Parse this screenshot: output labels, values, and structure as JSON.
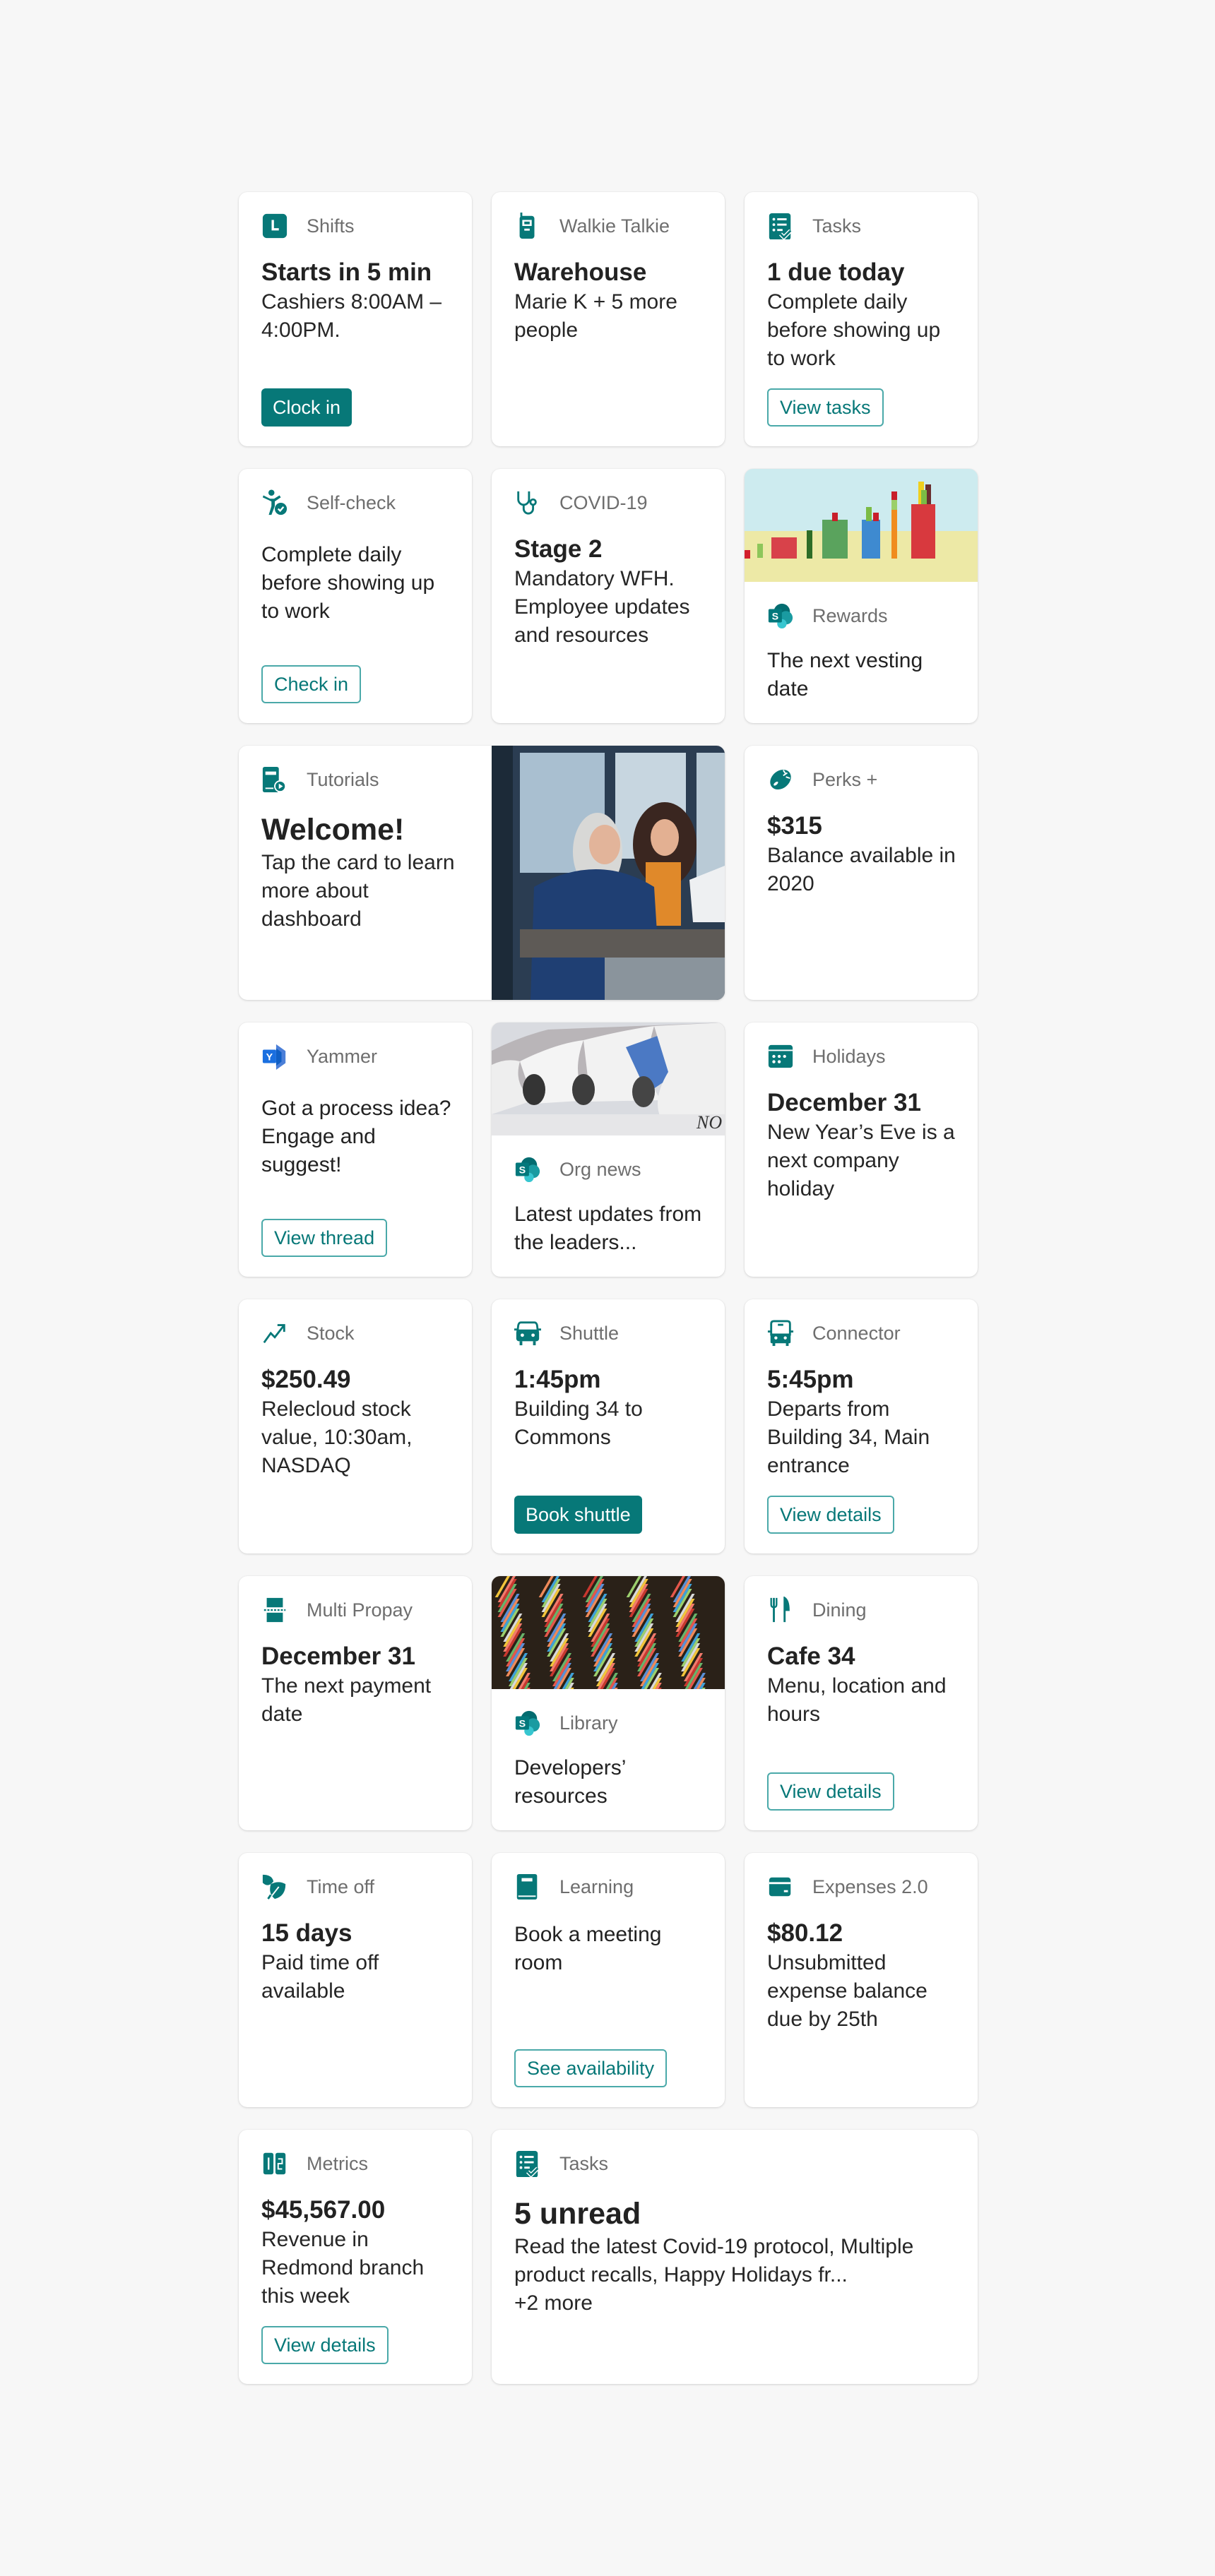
{
  "theme": {
    "accent": "#077878",
    "accent_border": "#4aa9a9",
    "page_bg": "#f7f7f7"
  },
  "cards": {
    "shifts": {
      "icon": "shifts-clock-icon",
      "label": "Shifts",
      "title": "Starts in 5 min",
      "body": "Cashiers 8:00AM – 4:00PM.",
      "button": "Clock in"
    },
    "walkie": {
      "icon": "walkie-talkie-icon",
      "label": "Walkie Talkie",
      "title": "Warehouse",
      "body": "Marie K + 5 more people"
    },
    "tasks1": {
      "icon": "tasks-checklist-icon",
      "label": "Tasks",
      "title": "1 due today",
      "body": "Complete daily before showing up to work",
      "button": "View tasks"
    },
    "selfcheck": {
      "icon": "self-check-person-icon",
      "label": "Self-check",
      "body": "Complete daily before showing up to work",
      "button": "Check in"
    },
    "covid": {
      "icon": "stethoscope-icon",
      "label": "COVID-19",
      "title": "Stage 2",
      "body": "Mandatory WFH. Employee updates and resources"
    },
    "rewards": {
      "icon": "sharepoint-icon",
      "label": "Rewards",
      "body": "The next vesting date",
      "image": "colorful-blocks-bar-photo"
    },
    "tutorials": {
      "icon": "tutorial-book-play-icon",
      "label": "Tutorials",
      "title": "Welcome!",
      "body": "Tap the card to learn more about dashboard",
      "image": "two-women-at-desk-photo"
    },
    "perks": {
      "icon": "perks-ball-icon",
      "label": "Perks +",
      "title": "$315",
      "body": "Balance available in 2020"
    },
    "yammer": {
      "icon": "yammer-icon",
      "label": "Yammer",
      "body": "Got a process idea? Engage and suggest!",
      "button": "View thread"
    },
    "orgnews": {
      "icon": "sharepoint-icon",
      "label": "Org news",
      "body": "Latest updates from the leaders...",
      "image": "newspapers-photo"
    },
    "holidays": {
      "icon": "calendar-icon",
      "label": "Holidays",
      "title": "December 31",
      "body": "New Year’s Eve is a next company holiday"
    },
    "stock": {
      "icon": "trending-up-icon",
      "label": "Stock",
      "title": "$250.49",
      "body": "Relecloud stock value, 10:30am, NASDAQ"
    },
    "shuttle": {
      "icon": "vehicle-car-icon",
      "label": "Shuttle",
      "title": "1:45pm",
      "body": "Building 34 to Commons",
      "button": "Book shuttle"
    },
    "connector": {
      "icon": "bus-icon",
      "label": "Connector",
      "title": "5:45pm",
      "body": "Departs from Building 34, Main entrance",
      "button": "View details"
    },
    "propay": {
      "icon": "split-payment-icon",
      "label": "Multi Propay",
      "title": "December 31",
      "body": "The next payment date"
    },
    "library": {
      "icon": "sharepoint-icon",
      "label": "Library",
      "body": "Developers’ resources",
      "image": "bookshelves-photo"
    },
    "dining": {
      "icon": "fork-knife-icon",
      "label": "Dining",
      "title": "Cafe 34",
      "body": "Menu, location and hours",
      "button": "View details"
    },
    "timeoff": {
      "icon": "leaf-icon",
      "label": "Time off",
      "title": "15 days",
      "body": "Paid time off available"
    },
    "learning": {
      "icon": "book-icon",
      "label": "Learning",
      "body": "Book a meeting room",
      "button": "See availability"
    },
    "expenses": {
      "icon": "wallet-card-icon",
      "label": "Expenses 2.0",
      "title": "$80.12",
      "body": "Unsubmitted expense balance due by 25th"
    },
    "metrics": {
      "icon": "metrics-number-icon",
      "label": "Metrics",
      "title": "$45,567.00",
      "body": "Revenue in Redmond branch this week",
      "button": "View details"
    },
    "tasks2": {
      "icon": "tasks-checklist-icon",
      "label": "Tasks",
      "title": "5 unread",
      "body": "Read the latest Covid-19 protocol, Multiple product recalls, Happy Holidays fr...",
      "more": "+2 more"
    }
  }
}
